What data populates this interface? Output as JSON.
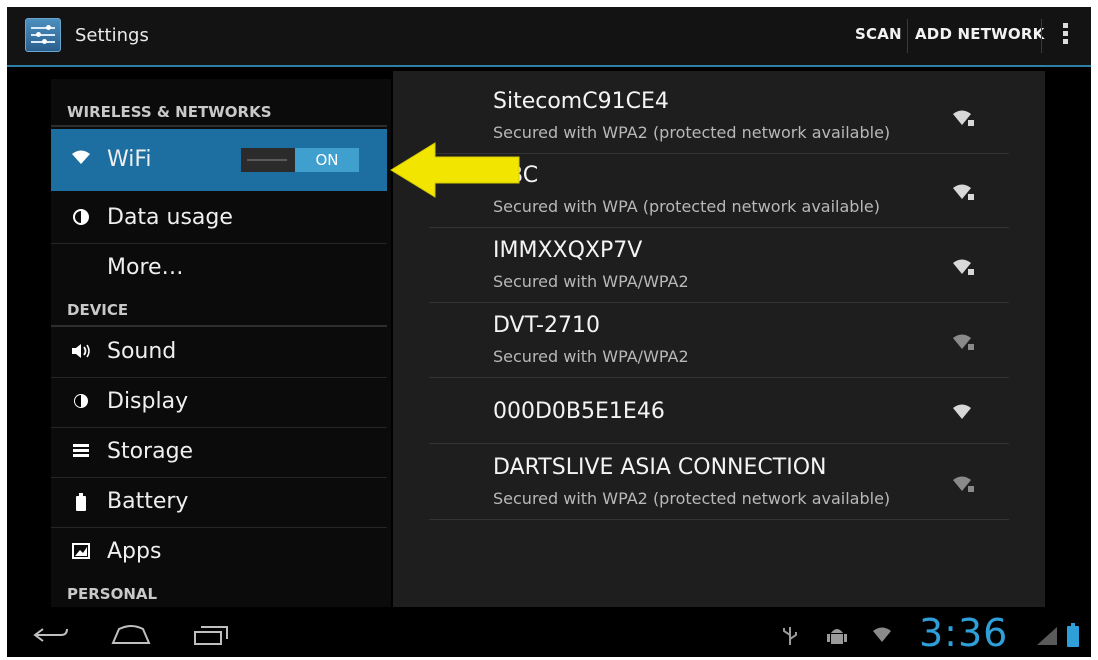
{
  "actionbar": {
    "title": "Settings",
    "scan_label": "SCAN",
    "add_network_label": "ADD NETWORK"
  },
  "sidebar": {
    "sections": [
      {
        "label": "WIRELESS & NETWORKS"
      },
      {
        "label": "DEVICE"
      },
      {
        "label": "PERSONAL"
      }
    ],
    "items": [
      {
        "label": "WiFi",
        "icon": "wifi-icon",
        "selected": true,
        "toggle": "ON"
      },
      {
        "label": "Data usage",
        "icon": "data-usage-icon"
      },
      {
        "label": "More…"
      },
      {
        "label": "Sound",
        "icon": "sound-icon"
      },
      {
        "label": "Display",
        "icon": "display-icon"
      },
      {
        "label": "Storage",
        "icon": "storage-icon"
      },
      {
        "label": "Battery",
        "icon": "battery-icon"
      },
      {
        "label": "Apps",
        "icon": "apps-icon"
      }
    ]
  },
  "networks": [
    {
      "name": "SitecomC91CE4",
      "security": "Secured with WPA2 (protected network available)",
      "icon": "wifi-locked-icon"
    },
    {
      "name": "ABC",
      "security": "Secured with WPA (protected network available)",
      "icon": "wifi-locked-icon"
    },
    {
      "name": "IMMXXQXP7V",
      "security": "Secured with WPA/WPA2",
      "icon": "wifi-locked-icon"
    },
    {
      "name": "DVT-2710",
      "security": "Secured with WPA/WPA2",
      "icon": "wifi-locked-icon"
    },
    {
      "name": "000D0B5E1E46",
      "security": "",
      "icon": "wifi-open-icon"
    },
    {
      "name": "DARTSLIVE ASIA CONNECTION",
      "security": "Secured with WPA2 (protected network available)",
      "icon": "wifi-locked-icon"
    }
  ],
  "statusbar": {
    "time": "3:36",
    "accent_color": "#2e9fd9"
  },
  "colors": {
    "selected_bg": "#1d6fa1",
    "arrow": "#f2e600"
  }
}
